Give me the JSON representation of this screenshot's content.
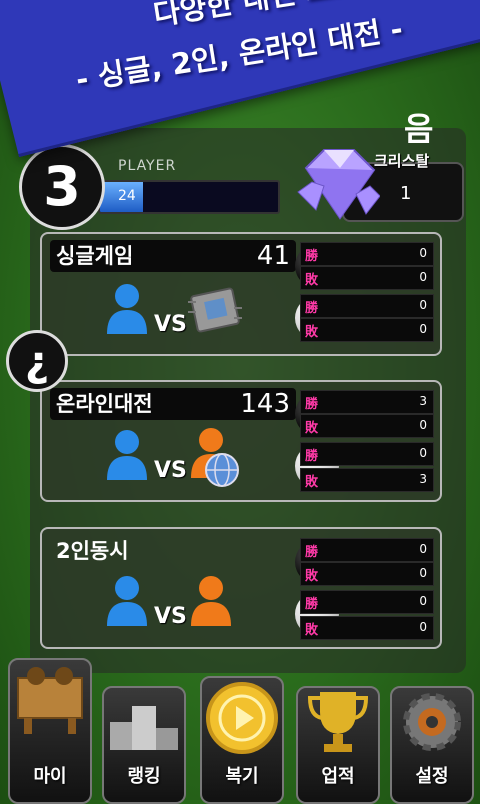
{
  "banner": {
    "line1": "다양한 대전 모드",
    "line2": "- 싱글, 2인, 온라인 대전 -"
  },
  "header": {
    "corner_glyph": "음",
    "level": "3",
    "player_label": "PLAYER",
    "xp_value": "24",
    "xp_fraction": 0.24,
    "crystal_label": "크리스탈",
    "crystal_value": "1"
  },
  "modes": [
    {
      "title": "싱글게임",
      "count": "41",
      "records": [
        {
          "label": "勝",
          "value": "0"
        },
        {
          "label": "敗",
          "value": "0"
        },
        {
          "label": "勝",
          "value": "0"
        },
        {
          "label": "敗",
          "value": "0"
        }
      ]
    },
    {
      "title": "온라인대전",
      "count": "143",
      "records": [
        {
          "label": "勝",
          "value": "3"
        },
        {
          "label": "敗",
          "value": "0"
        },
        {
          "label": "勝",
          "value": "0"
        },
        {
          "label": "敗",
          "value": "3"
        }
      ]
    },
    {
      "title": "2인동시",
      "count": "",
      "records": [
        {
          "label": "勝",
          "value": "0"
        },
        {
          "label": "敗",
          "value": "0"
        },
        {
          "label": "勝",
          "value": "0"
        },
        {
          "label": "敗",
          "value": "0"
        }
      ]
    }
  ],
  "vs_label": "VS",
  "help_label": "¿",
  "nav": [
    {
      "label": "마이",
      "icon": "go-board-icon"
    },
    {
      "label": "랭킹",
      "icon": "podium-icon"
    },
    {
      "label": "복기",
      "icon": "replay-coin-icon"
    },
    {
      "label": "업적",
      "icon": "trophy-icon"
    },
    {
      "label": "설정",
      "icon": "gear-icon"
    }
  ],
  "colors": {
    "banner": "#2f38b8",
    "background": "#2a6b1c",
    "win_loss_label": "#ff3aa8",
    "player_blue": "#2a8be8",
    "player_orange": "#f07a1a"
  }
}
